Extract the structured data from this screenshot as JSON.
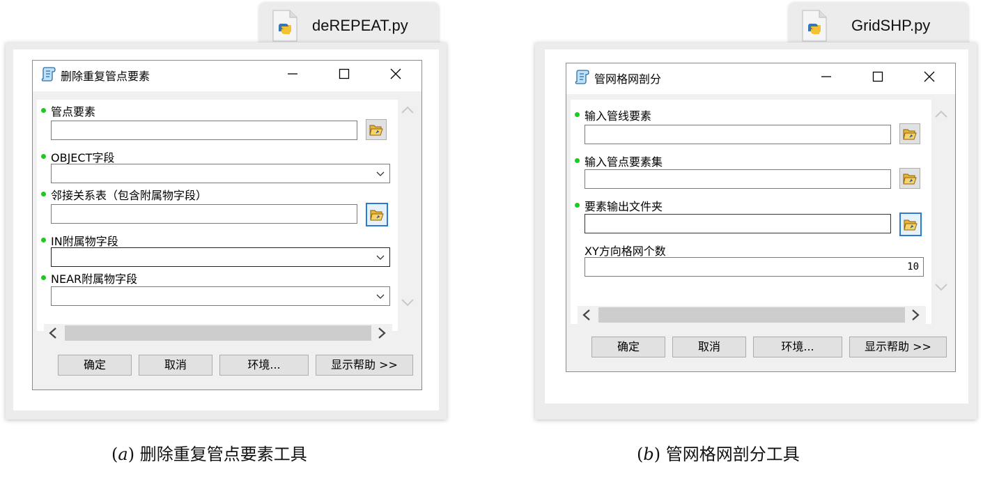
{
  "left": {
    "file_name": "deREPEAT.py",
    "dialog_title": "删除重复管点要素",
    "params": [
      {
        "label": "管点要素",
        "required": true,
        "type": "file"
      },
      {
        "label": "OBJECT字段",
        "required": true,
        "type": "dropdown"
      },
      {
        "label": "邻接关系表（包含附属物字段）",
        "required": true,
        "type": "file"
      },
      {
        "label": "IN附属物字段",
        "required": true,
        "type": "dropdown"
      },
      {
        "label": "NEAR附属物字段",
        "required": true,
        "type": "dropdown"
      }
    ],
    "buttons": {
      "ok": "确定",
      "cancel": "取消",
      "env": "环境...",
      "help": "显示帮助 >>"
    },
    "caption_letter": "a",
    "caption_open": "(",
    "caption_close": ")",
    "caption_text": "删除重复管点要素工具"
  },
  "right": {
    "file_name": "GridSHP.py",
    "dialog_title": "管网格网剖分",
    "params": [
      {
        "label": "输入管线要素",
        "required": true,
        "type": "file"
      },
      {
        "label": "输入管点要素集",
        "required": true,
        "type": "file"
      },
      {
        "label": "要素输出文件夹",
        "required": true,
        "type": "folder"
      },
      {
        "label": "XY方向格网个数",
        "required": false,
        "type": "number",
        "value": "10"
      }
    ],
    "buttons": {
      "ok": "确定",
      "cancel": "取消",
      "env": "环境...",
      "help": "显示帮助 >>"
    },
    "caption_letter": "b",
    "caption_open": "(",
    "caption_close": ")",
    "caption_text": "管网格网剖分工具"
  },
  "colors": {
    "bullet": "#1ccb1c",
    "focus": "#2b7bd4",
    "frame": "#ececec"
  },
  "icons": [
    "python-file-icon",
    "script-tool-icon",
    "minimize-icon",
    "maximize-icon",
    "close-icon",
    "open-folder-icon",
    "chevron-down-icon",
    "chevron-up-icon",
    "chevron-left-icon",
    "chevron-right-icon"
  ]
}
